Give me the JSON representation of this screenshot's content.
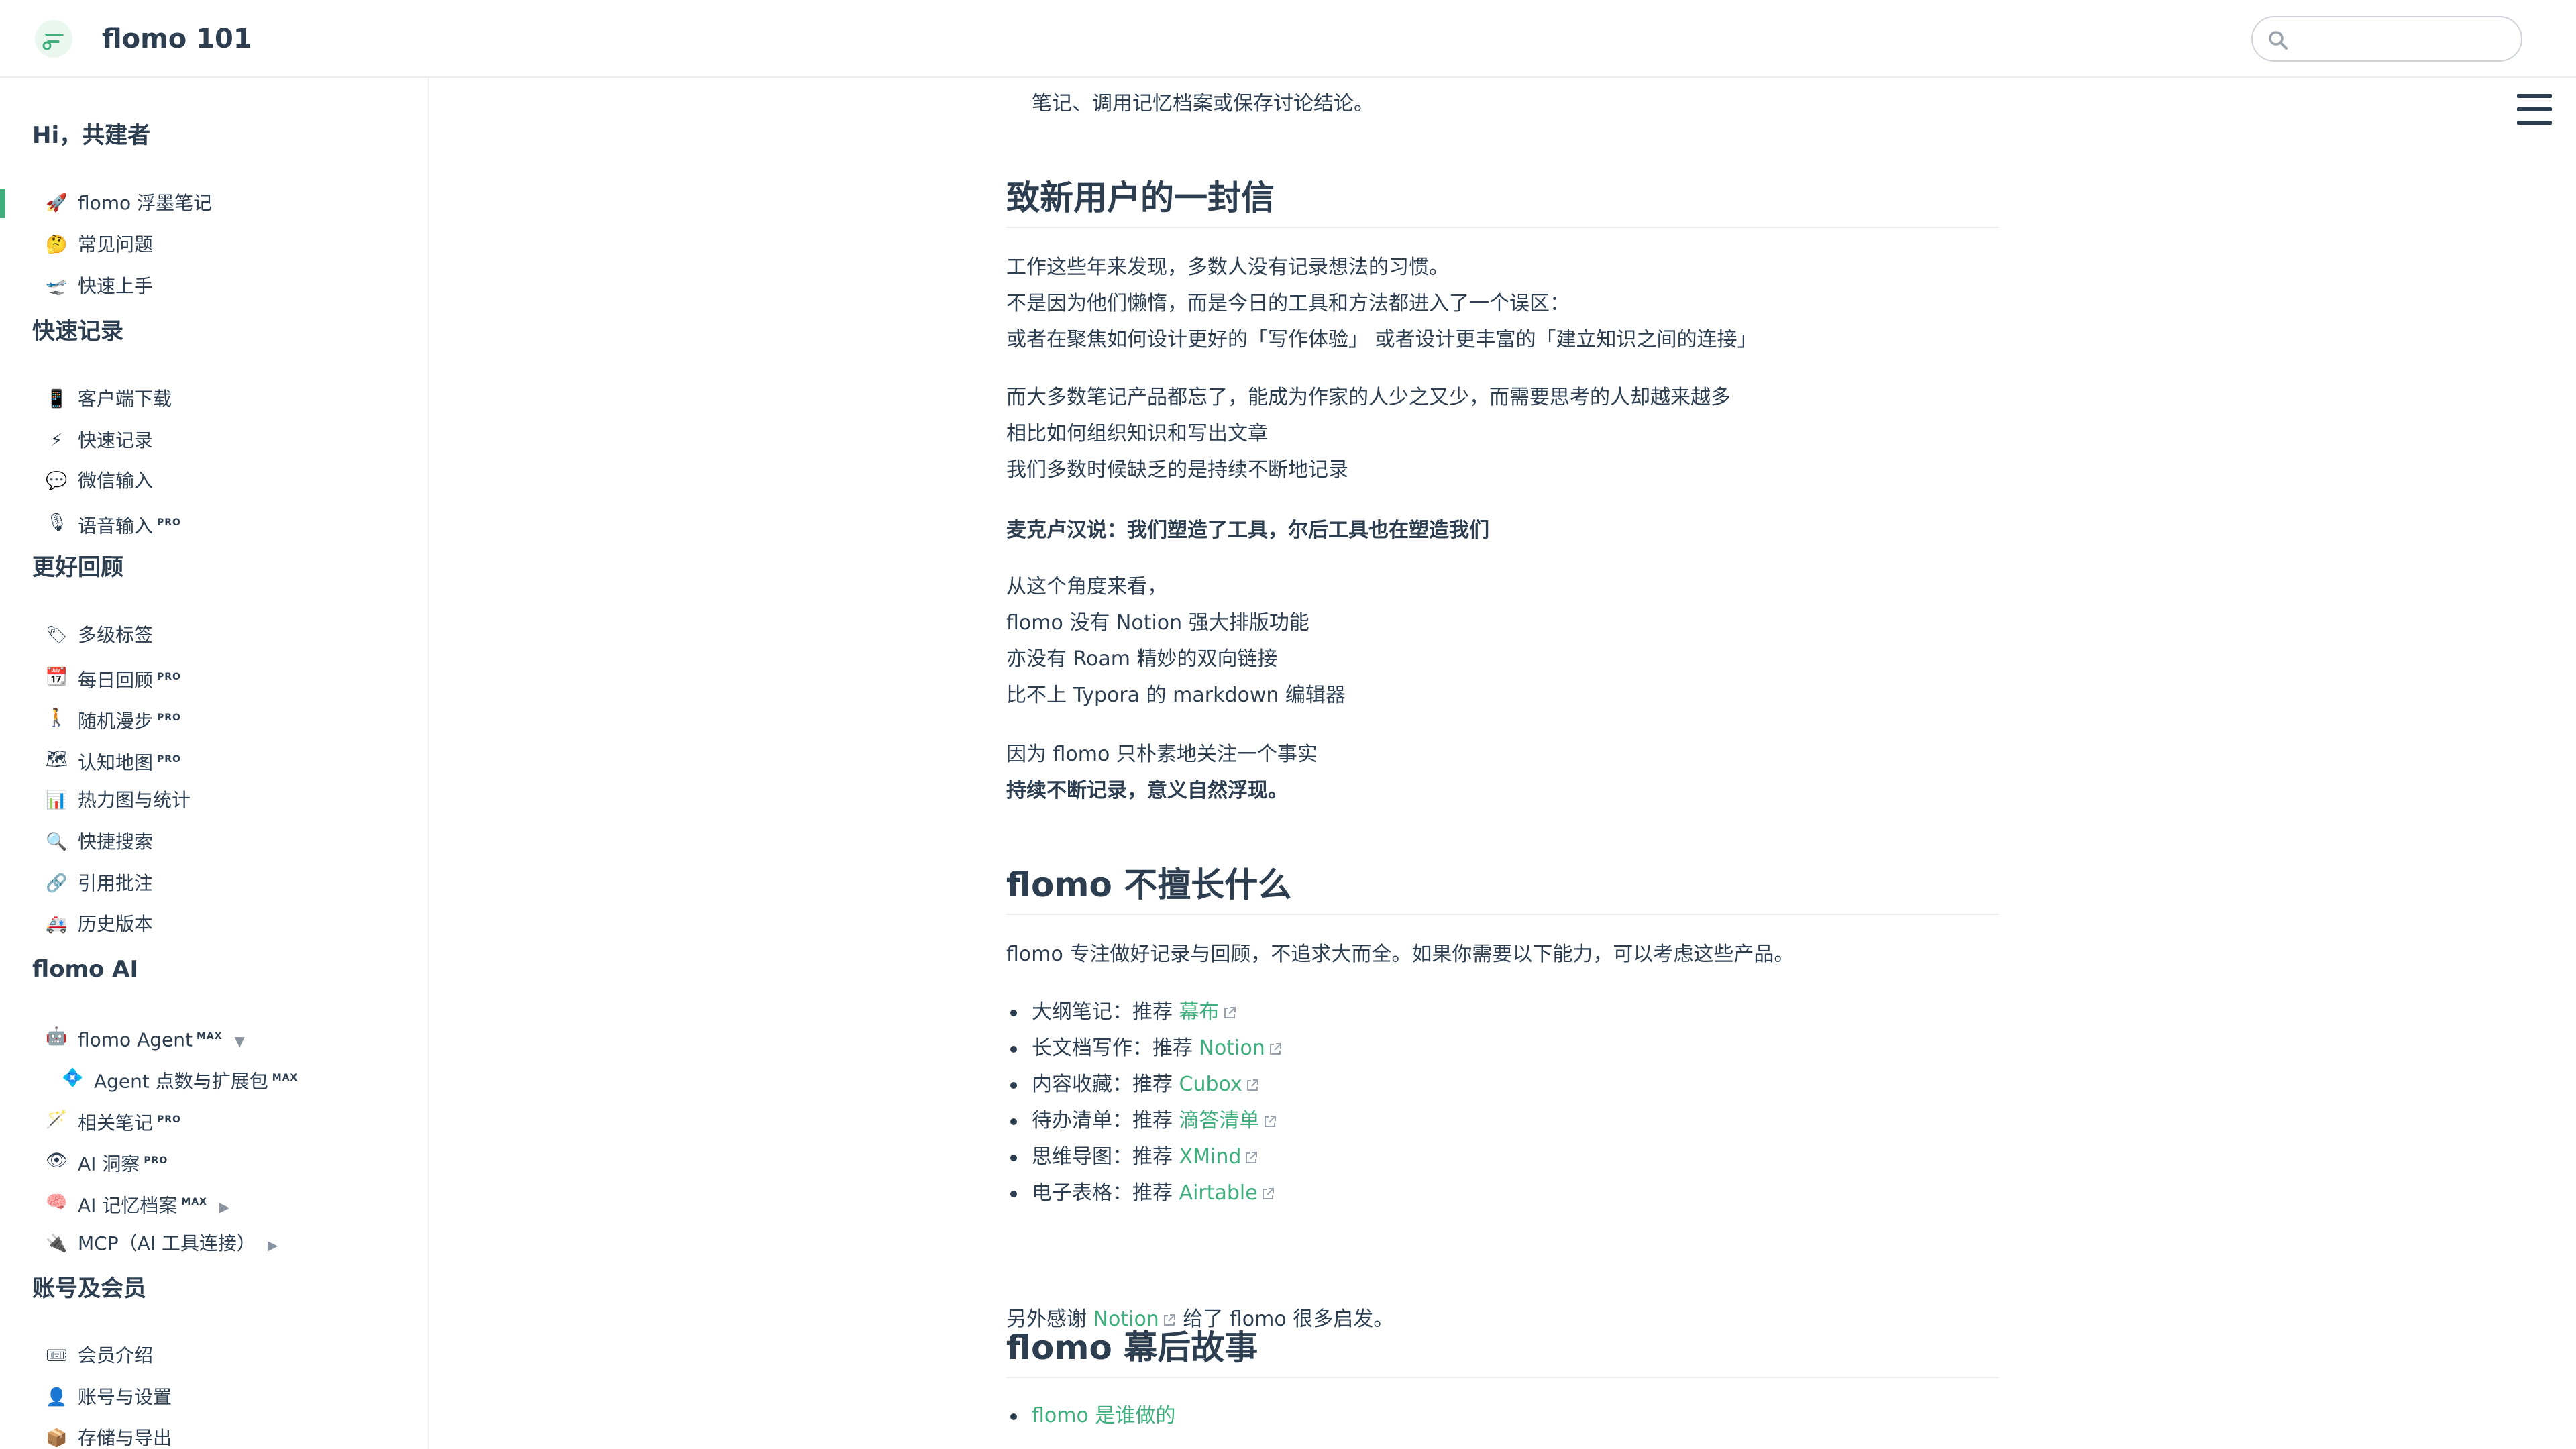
{
  "header": {
    "title": "flomo 101",
    "search_placeholder": ""
  },
  "sidebar": {
    "groups": [
      {
        "title": "Hi，共建者",
        "items": [
          {
            "emoji": "🚀",
            "label": "flomo 浮墨笔记"
          },
          {
            "emoji": "🤔",
            "label": "常见问题"
          },
          {
            "emoji": "🛫",
            "label": "快速上手"
          }
        ]
      },
      {
        "title": "快速记录",
        "items": [
          {
            "emoji": "📱",
            "label": "客户端下载"
          },
          {
            "emoji": "⚡",
            "label": "快速记录"
          },
          {
            "emoji": "💬",
            "label": "微信输入"
          },
          {
            "emoji": "🎙",
            "label": "语音输入",
            "badge": "PRO"
          }
        ]
      },
      {
        "title": "更好回顾",
        "items": [
          {
            "emoji": "🏷",
            "label": "多级标签"
          },
          {
            "emoji": "📆",
            "label": "每日回顾",
            "badge": "PRO"
          },
          {
            "emoji": "🚶",
            "label": "随机漫步",
            "badge": "PRO"
          },
          {
            "emoji": "🗺",
            "label": "认知地图",
            "badge": "PRO"
          },
          {
            "emoji": "📊",
            "label": "热力图与统计"
          },
          {
            "emoji": "🔍",
            "label": "快捷搜索"
          },
          {
            "emoji": "🔗",
            "label": "引用批注"
          },
          {
            "emoji": "🚑",
            "label": "历史版本"
          }
        ]
      },
      {
        "title": "flomo AI",
        "items": [
          {
            "emoji": "🤖",
            "label": "flomo Agent",
            "badge": "MAX"
          },
          {
            "emoji": "💠",
            "label": "Agent 点数与扩展包",
            "badge": "MAX"
          },
          {
            "emoji": "🪄",
            "label": "相关笔记",
            "badge": "PRO"
          },
          {
            "emoji": "👁",
            "label": "AI 洞察",
            "badge": "PRO"
          },
          {
            "emoji": "🧠",
            "label": "AI 记忆档案",
            "badge": "MAX"
          },
          {
            "emoji": "🔌",
            "label": "MCP（AI 工具连接）"
          }
        ]
      },
      {
        "title": "账号及会员",
        "items": [
          {
            "emoji": "🎟",
            "label": "会员介绍"
          },
          {
            "emoji": "👤",
            "label": "账号与设置"
          },
          {
            "emoji": "📦",
            "label": "存储与导出"
          }
        ]
      }
    ]
  },
  "content": {
    "top_line": "笔记、调用记忆档案或保存讨论结论。",
    "s1": {
      "heading": "致新用户的一封信",
      "p1": [
        "工作这些年来发现，多数人没有记录想法的习惯。",
        "不是因为他们懒惰，而是今日的工具和方法都进入了一个误区：",
        "或者在聚焦如何设计更好的「写作体验」 或者设计更丰富的「建立知识之间的连接」"
      ],
      "p2": [
        "而大多数笔记产品都忘了，能成为作家的人少之又少，而需要思考的人却越来越多",
        "相比如何组织知识和写出文章",
        "我们多数时候缺乏的是持续不断地记录"
      ],
      "quote": "麦克卢汉说：我们塑造了工具，尔后工具也在塑造我们",
      "p3": [
        "从这个角度来看，",
        "flomo 没有 Notion 强大排版功能",
        "亦没有 Roam 精妙的双向链接",
        "比不上 Typora 的 markdown 编辑器"
      ],
      "p4_line": "因为 flomo 只朴素地关注一个事实",
      "p4_bold": "持续不断记录，意义自然浮现。"
    },
    "s2": {
      "heading": "flomo 不擅长什么",
      "intro": "flomo 专注做好记录与回顾，不追求大而全。如果你需要以下能力，可以考虑这些产品。",
      "items": [
        {
          "prefix": "大纲笔记：推荐 ",
          "link": "幕布"
        },
        {
          "prefix": "长文档写作：推荐 ",
          "link": "Notion"
        },
        {
          "prefix": "内容收藏：推荐 ",
          "link": "Cubox"
        },
        {
          "prefix": "待办清单：推荐 ",
          "link": "滴答清单"
        },
        {
          "prefix": "思维导图：推荐 ",
          "link": "XMind"
        },
        {
          "prefix": "电子表格：推荐 ",
          "link": "Airtable"
        }
      ],
      "thanks_prefix": "另外感谢 ",
      "thanks_link": "Notion",
      "thanks_suffix": " 给了 flomo 很多启发。"
    },
    "s3": {
      "heading": "flomo 幕后故事",
      "items": [
        "flomo 是谁做的"
      ]
    }
  },
  "colors": {
    "accent": "#3eaf7c",
    "text": "#2c3e50",
    "border": "#eaecef"
  }
}
